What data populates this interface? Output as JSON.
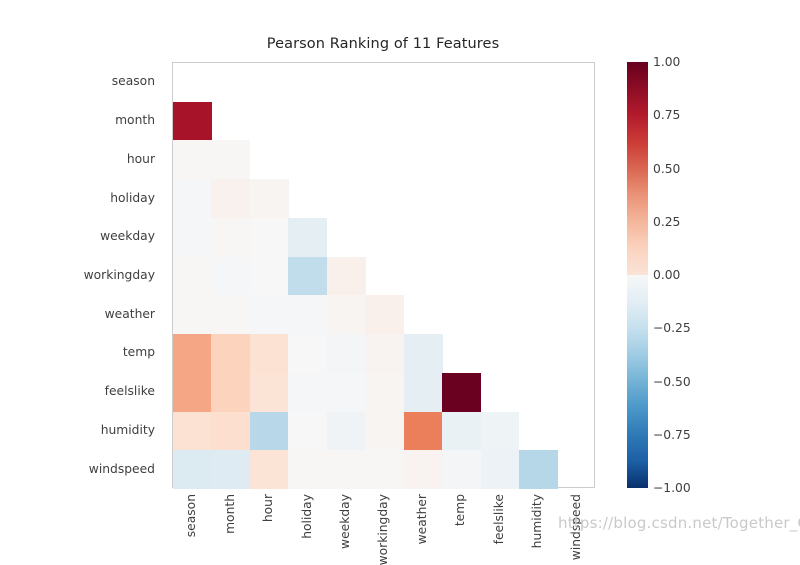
{
  "chart_data": {
    "type": "heatmap",
    "title": "Pearson Ranking of 11 Features",
    "xlabel": "",
    "ylabel": "",
    "grid": false,
    "colormap": "RdBu_r",
    "mask": "lower-triangle",
    "colorbar": {
      "position": "right",
      "vmin": -1.0,
      "vmax": 1.0,
      "ticks": [
        "1.00",
        "0.75",
        "0.50",
        "0.25",
        "0.00",
        "−0.25",
        "−0.50",
        "−0.75",
        "−1.00"
      ],
      "tick_values": [
        1.0,
        0.75,
        0.5,
        0.25,
        0.0,
        -0.25,
        -0.5,
        -0.75,
        -1.0
      ]
    },
    "x_categories": [
      "season",
      "month",
      "hour",
      "holiday",
      "weekday",
      "workingday",
      "weather",
      "temp",
      "feelslike",
      "humidity",
      "windspeed"
    ],
    "y_categories": [
      "season",
      "month",
      "hour",
      "holiday",
      "weekday",
      "workingday",
      "weather",
      "temp",
      "feelslike",
      "humidity",
      "windspeed"
    ],
    "values": [
      [
        null,
        null,
        null,
        null,
        null,
        null,
        null,
        null,
        null,
        null,
        null
      ],
      [
        0.83,
        null,
        null,
        null,
        null,
        null,
        null,
        null,
        null,
        null,
        null
      ],
      [
        0.01,
        0.01,
        null,
        null,
        null,
        null,
        null,
        null,
        null,
        null,
        null
      ],
      [
        -0.01,
        0.04,
        0.02,
        null,
        null,
        null,
        null,
        null,
        null,
        null,
        null
      ],
      [
        -0.01,
        0.01,
        0.0,
        -0.1,
        null,
        null,
        null,
        null,
        null,
        null,
        null
      ],
      [
        0.01,
        -0.01,
        0.0,
        -0.25,
        0.05,
        null,
        null,
        null,
        null,
        null,
        null
      ],
      [
        0.01,
        0.01,
        -0.01,
        -0.01,
        0.02,
        0.05,
        null,
        null,
        null,
        null,
        null
      ],
      [
        0.33,
        0.22,
        0.15,
        0.0,
        -0.02,
        0.03,
        -0.1,
        null,
        null,
        null,
        null
      ],
      [
        0.33,
        0.22,
        0.14,
        -0.01,
        -0.01,
        0.02,
        -0.1,
        0.99,
        null,
        null,
        null
      ],
      [
        0.15,
        0.17,
        -0.28,
        0.0,
        -0.04,
        0.02,
        0.42,
        -0.07,
        -0.05,
        null,
        null
      ],
      [
        -0.14,
        -0.13,
        0.14,
        0.01,
        0.01,
        0.01,
        0.03,
        -0.02,
        -0.06,
        -0.29,
        null
      ]
    ]
  },
  "watermark": {
    "text": "https://blog.csdn.net/Together_CZ"
  }
}
